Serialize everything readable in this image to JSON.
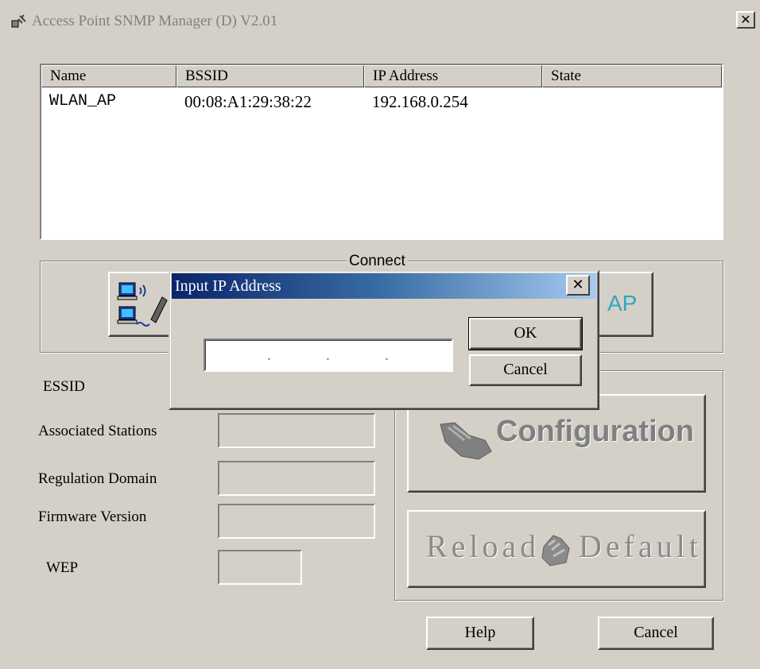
{
  "window": {
    "title": "Access Point SNMP Manager (D) V2.01",
    "close_glyph": "✕"
  },
  "list": {
    "columns": [
      "Name",
      "BSSID",
      "IP Address",
      "State"
    ],
    "rows": [
      {
        "name": "WLAN_AP",
        "bssid": "00:08:A1:29:38:22",
        "ip": "192.168.0.254",
        "state": ""
      }
    ]
  },
  "connect_group": {
    "label": "Connect",
    "buttons": [
      {
        "label": "",
        "icon": "network-computers-icon"
      },
      {
        "label": "AP",
        "icon": ""
      }
    ]
  },
  "info_fields": {
    "essid": {
      "label": "ESSID",
      "value": ""
    },
    "associated_stations": {
      "label": "Associated Stations",
      "value": ""
    },
    "regulation_domain": {
      "label": "Regulation Domain",
      "value": ""
    },
    "firmware_version": {
      "label": "Firmware Version",
      "value": ""
    },
    "wep": {
      "label": "WEP",
      "value": ""
    }
  },
  "actions": {
    "configuration": {
      "label": "Configuration",
      "icon": "hand-wrench-icon"
    },
    "reload_default": {
      "label_left": "Reload",
      "label_right": "Default",
      "icon": "hand-stamp-icon"
    },
    "help": "Help",
    "cancel": "Cancel"
  },
  "dialog": {
    "title": "Input IP Address",
    "ip_value": "",
    "ip_separator": ".",
    "ok": "OK",
    "cancel": "Cancel",
    "close_glyph": "✕"
  },
  "colors": {
    "face": "#d4d0c8",
    "title_gradient_start": "#0a246a",
    "title_gradient_end": "#a6caf0",
    "ap_text": "#2fa6c0"
  }
}
